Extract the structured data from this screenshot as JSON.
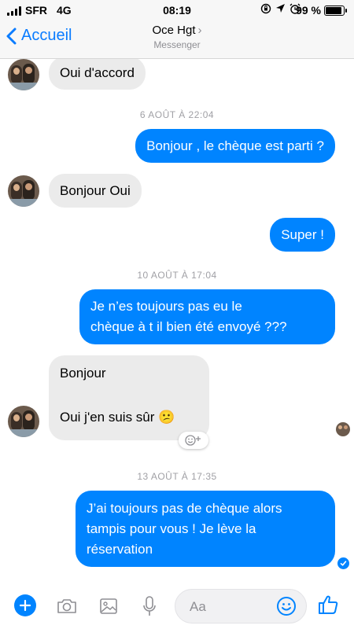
{
  "status": {
    "carrier": "SFR",
    "network": "4G",
    "time": "08:19",
    "battery": "99 %",
    "battery_level": 0.99,
    "icons": [
      "lock-rotation-icon",
      "location-icon",
      "alarm-icon"
    ]
  },
  "header": {
    "back_label": "Accueil",
    "contact_name": "Oce Hgt",
    "contact_sub": "Messenger"
  },
  "messages": [
    {
      "side": "in",
      "text": "Oui d'accord"
    },
    {
      "timestamp": "6 AOÛT À 22:04"
    },
    {
      "side": "out",
      "text": "Bonjour , le chèque est parti ?"
    },
    {
      "side": "in",
      "text": "Bonjour Oui"
    },
    {
      "side": "out",
      "text": "Super !"
    },
    {
      "timestamp": "10 AOÛT À 17:04"
    },
    {
      "side": "out",
      "lines": [
        "Je n’es toujours pas eu le",
        "chèque à t il bien été envoyé ???"
      ]
    },
    {
      "side": "in",
      "lines": [
        "Bonjour",
        "",
        "Oui j'en suis sûr 😕"
      ]
    },
    {
      "timestamp": "13 AOÛT À 17:35"
    },
    {
      "side": "out",
      "lines": [
        "J’ai toujours pas de chèque alors",
        "tampis pour vous ! Je lève la",
        "réservation"
      ]
    }
  ],
  "composer": {
    "placeholder": "Aa",
    "icons": [
      "plus-icon",
      "camera-icon",
      "photo-icon",
      "microphone-icon",
      "emoji-icon",
      "thumbs-up-icon"
    ]
  },
  "colors": {
    "accent": "#0084ff",
    "incoming_bubble": "#ebebeb",
    "header_link": "#0a7cff",
    "timestamp": "#a0a0a5"
  }
}
